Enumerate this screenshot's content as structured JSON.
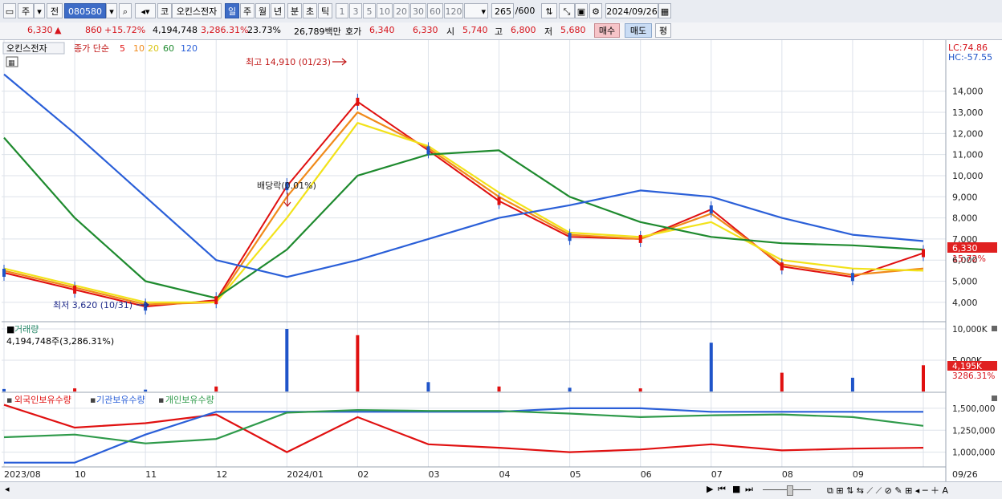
{
  "toolbar": {
    "market": "주",
    "prefix": "전",
    "code": "080580",
    "name_btn": "코",
    "stock_name": "오킨스전자",
    "periods": [
      "일",
      "주",
      "월",
      "년",
      "분",
      "초",
      "틱"
    ],
    "active_period": "일",
    "counts": [
      "1",
      "3",
      "5",
      "10",
      "20",
      "30",
      "60",
      "120"
    ],
    "page_count": "265",
    "page_total": "/600",
    "date": "2024/09/26"
  },
  "quote": {
    "price": "6,330",
    "arrow": "▲",
    "change": "860",
    "change_pct": "+15.72%",
    "volume": "4,194,748",
    "volume_pct": "3,286.31%",
    "turnover": "23.73%",
    "amount": "26,789백만",
    "ask_label": "호가",
    "ask": "6,340",
    "bid": "6,330",
    "open_label": "시",
    "open": "5,740",
    "high_label": "고",
    "high": "6,800",
    "low_label": "저",
    "low": "5,680",
    "buy_label": "매수",
    "sell_label": "매도",
    "eval_label": "평"
  },
  "price_panel": {
    "stock_tag": "오킨스전자",
    "ma_label": "종가 단순",
    "ma_periods": [
      "5",
      "10",
      "20",
      "60",
      "120"
    ],
    "ma_colors": [
      "#e01010",
      "#f08a1a",
      "#f2e21a",
      "#1e8a2e",
      "#2a5fd8"
    ],
    "lc": "LC:74.86",
    "hc": "HC:-57.55",
    "high_annotation": "최고 14,910 (01/23)",
    "low_annotation": "최저 3,620 (10/31)",
    "dividend_annotation": "배당락(0.01%)",
    "last_price_tag": "6,330",
    "last_pct_tag": "15.72%",
    "y_ticks": [
      "14,000",
      "13,000",
      "12,000",
      "11,000",
      "10,000",
      "9,000",
      "8,000",
      "7,000",
      "6,000",
      "5,000",
      "4,000"
    ]
  },
  "volume_panel": {
    "title": "거래량",
    "value": "4,194,748주(3,286.31%)",
    "y_ticks": [
      "10,000K",
      "5,000K"
    ],
    "last_tag": "4,195K",
    "last_pct": "3286.31%"
  },
  "holding_panel": {
    "series": [
      "외국인보유수량",
      "기관보유수량",
      "개인보유수량"
    ],
    "series_colors": [
      "#e01010",
      "#2a5fd8",
      "#2e9a4a"
    ],
    "y_ticks": [
      "1,500,000",
      "1,250,000",
      "1,000,000"
    ]
  },
  "x_axis": {
    "labels": [
      "2023/08",
      "10",
      "11",
      "12",
      "2024/01",
      "02",
      "03",
      "04",
      "05",
      "06",
      "07",
      "08",
      "09",
      "09/26"
    ]
  },
  "chart_data": {
    "type": "line",
    "title": "",
    "x": [
      "2023/08",
      "10",
      "11",
      "12",
      "2024/01",
      "02",
      "03",
      "04",
      "05",
      "06",
      "07",
      "08",
      "09",
      "09/26"
    ],
    "series": [
      {
        "name": "종가 단순 5",
        "values": [
          5400,
          4600,
          3800,
          4100,
          9500,
          13500,
          11200,
          8800,
          7100,
          7000,
          8400,
          5700,
          5200,
          6330
        ]
      },
      {
        "name": "종가 단순 10",
        "values": [
          5500,
          4700,
          3900,
          4000,
          9000,
          13000,
          11300,
          9000,
          7200,
          7000,
          8200,
          5800,
          5300,
          5600
        ]
      },
      {
        "name": "종가 단순 20",
        "values": [
          5600,
          4800,
          4000,
          4000,
          8000,
          12500,
          11400,
          9200,
          7300,
          7100,
          7800,
          6000,
          5600,
          5500
        ]
      },
      {
        "name": "종가 단순 60",
        "values": [
          11800,
          8000,
          5000,
          4200,
          6500,
          10000,
          11000,
          11200,
          9000,
          7800,
          7100,
          6800,
          6700,
          6500
        ]
      },
      {
        "name": "종가 단순 120",
        "values": [
          14800,
          12000,
          9000,
          6000,
          5200,
          6000,
          7000,
          8000,
          8600,
          9300,
          9000,
          8000,
          7200,
          6900
        ]
      }
    ],
    "ylim": [
      3500,
      14900
    ],
    "volume_ylim": [
      0,
      10000
    ],
    "holding_ylim": [
      850000,
      1600000
    ],
    "volume_k": [
      400,
      500,
      300,
      800,
      10000,
      9000,
      1500,
      800,
      600,
      500,
      7800,
      3000,
      2200,
      4195
    ],
    "holding": {
      "외국인보유수량": [
        1540000,
        1280000,
        1330000,
        1430000,
        1000000,
        1400000,
        1090000,
        1050000,
        1000000,
        1030000,
        1090000,
        1020000,
        1040000,
        1050000
      ],
      "기관보유수량": [
        880000,
        880000,
        1200000,
        1460000,
        1460000,
        1460000,
        1460000,
        1460000,
        1500000,
        1500000,
        1460000,
        1460000,
        1460000,
        1460000
      ],
      "개인보유수량": [
        1170000,
        1200000,
        1100000,
        1150000,
        1450000,
        1480000,
        1470000,
        1470000,
        1440000,
        1400000,
        1420000,
        1430000,
        1400000,
        1300000
      ]
    }
  },
  "footer": {
    "icons": [
      "play-icon",
      "first-icon",
      "stop-icon",
      "next-icon"
    ]
  }
}
